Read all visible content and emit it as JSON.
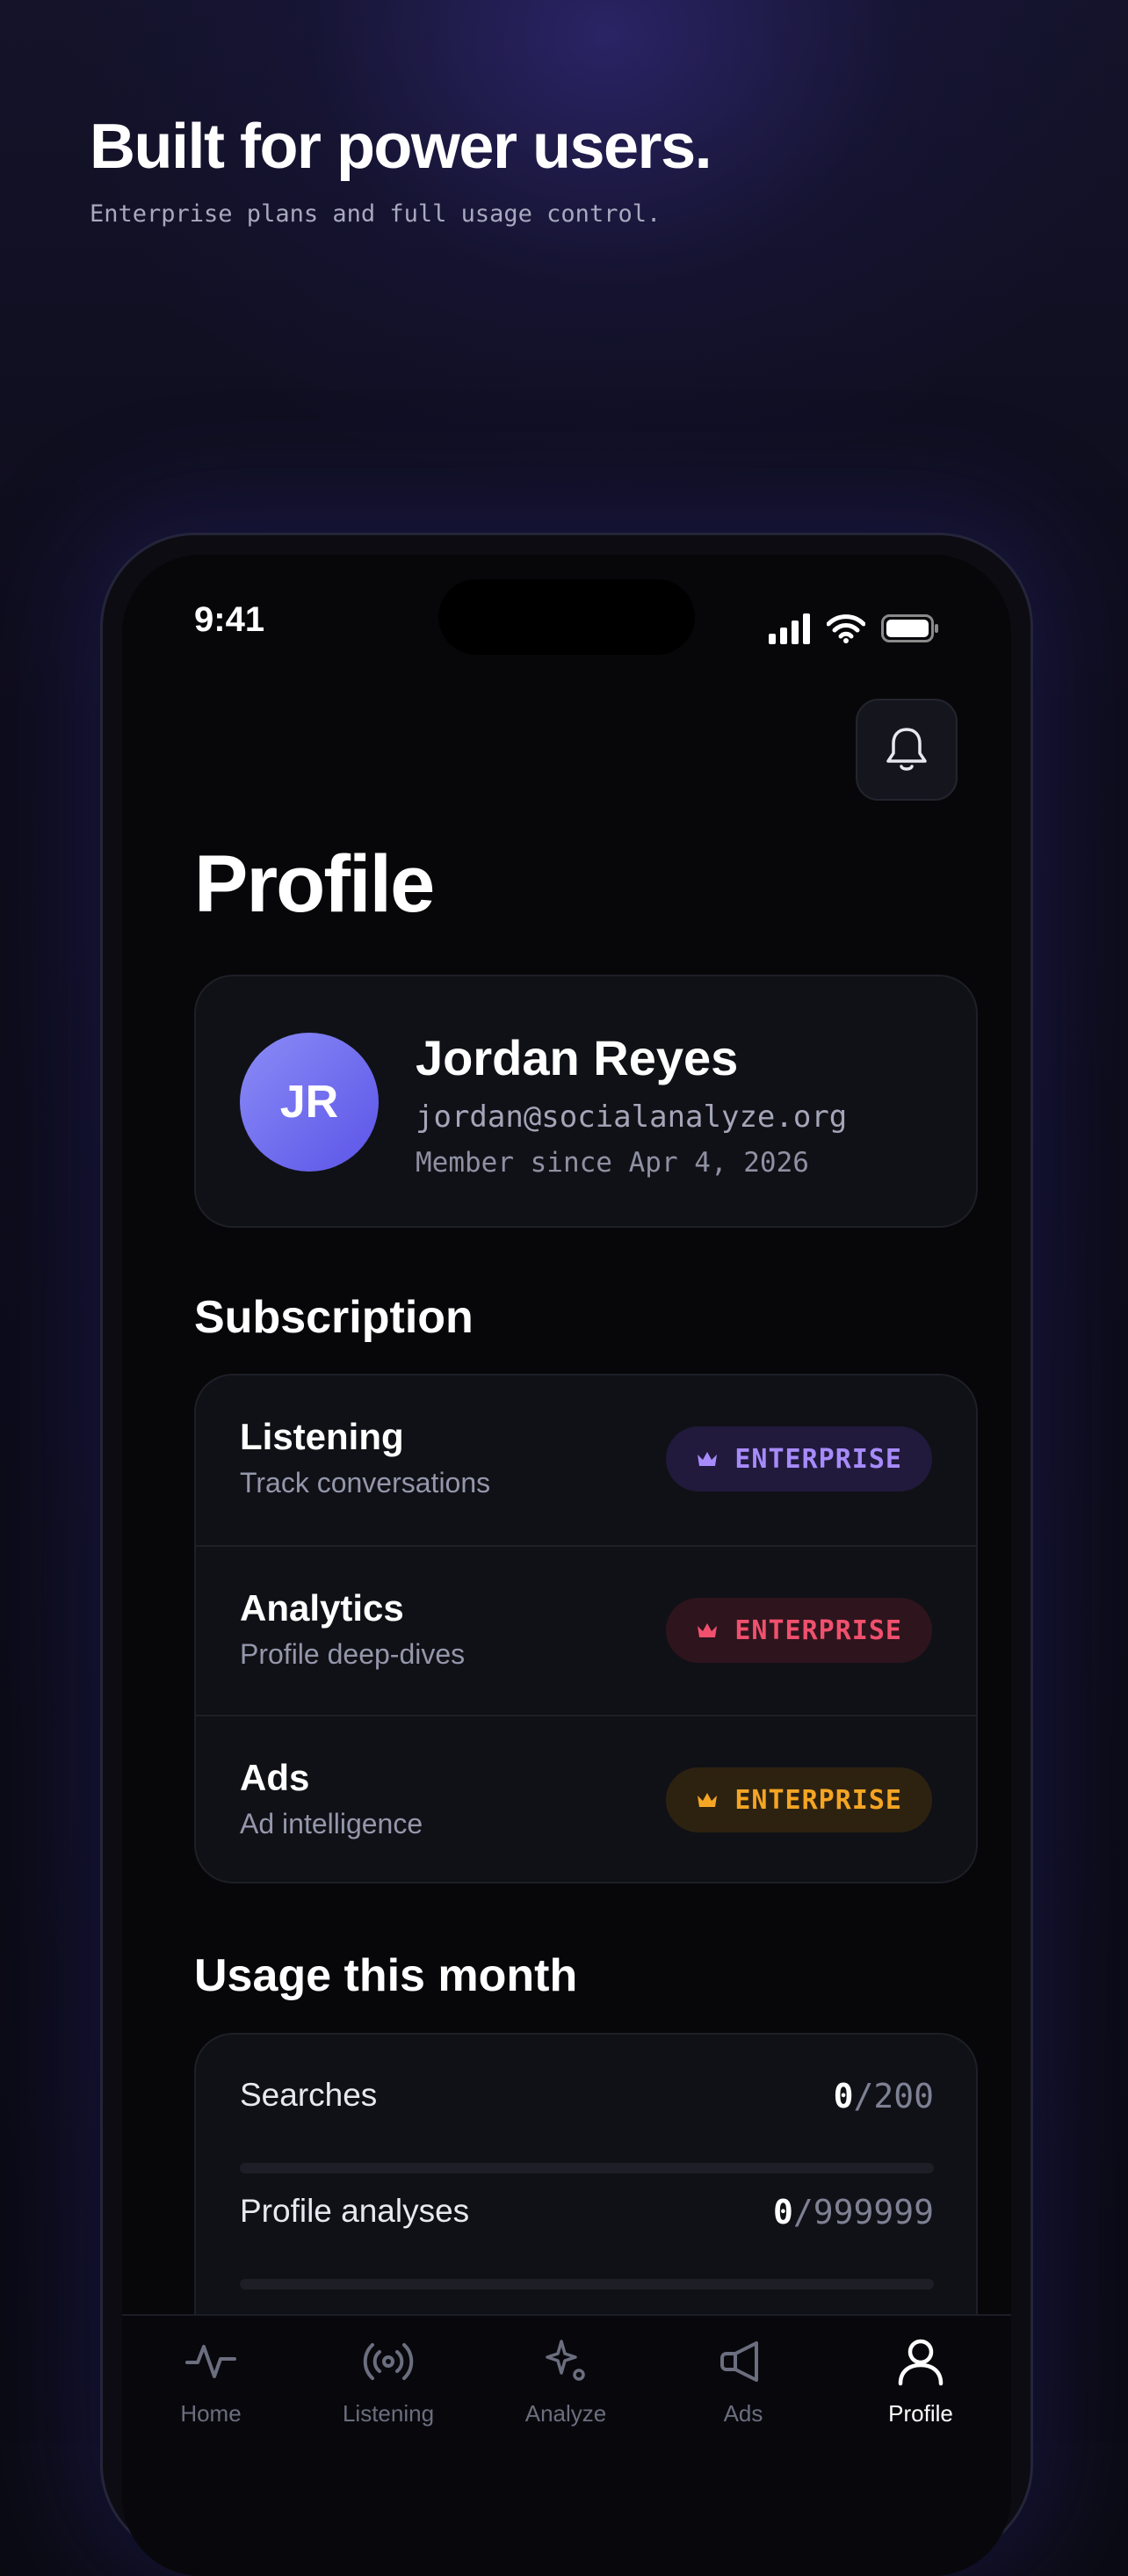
{
  "hero": {
    "title": "Built for power users.",
    "subtitle": "Enterprise plans and full usage control."
  },
  "status_bar": {
    "time": "9:41"
  },
  "header": {
    "title": "Profile",
    "bell_icon": "bell-icon"
  },
  "profile": {
    "initials": "JR",
    "name": "Jordan Reyes",
    "email": "jordan@socialanalyze.org",
    "member_since": "Member since Apr 4, 2026"
  },
  "subscription": {
    "title": "Subscription",
    "items": [
      {
        "name": "Listening",
        "description": "Track conversations",
        "plan": "ENTERPRISE",
        "color": "#a78bfa",
        "bg": "#211a3d"
      },
      {
        "name": "Analytics",
        "description": "Profile deep-dives",
        "plan": "ENTERPRISE",
        "color": "#f0506e",
        "bg": "#2e141c"
      },
      {
        "name": "Ads",
        "description": "Ad intelligence",
        "plan": "ENTERPRISE",
        "color": "#f5a524",
        "bg": "#2d2210"
      }
    ]
  },
  "usage": {
    "title": "Usage this month",
    "items": [
      {
        "label": "Searches",
        "used": "0",
        "limit": "/200",
        "fraction": 0
      },
      {
        "label": "Profile analyses",
        "used": "0",
        "limit": "/999999",
        "fraction": 0
      }
    ]
  },
  "tabbar": {
    "items": [
      {
        "label": "Home",
        "icon": "activity-icon",
        "active": false
      },
      {
        "label": "Listening",
        "icon": "broadcast-icon",
        "active": false
      },
      {
        "label": "Analyze",
        "icon": "sparkle-icon",
        "active": false
      },
      {
        "label": "Ads",
        "icon": "megaphone-icon",
        "active": false
      },
      {
        "label": "Profile",
        "icon": "user-icon",
        "active": true
      }
    ]
  },
  "colors": {
    "accent": "#6e6cf0",
    "background": "#07070a",
    "card": "#101116"
  }
}
